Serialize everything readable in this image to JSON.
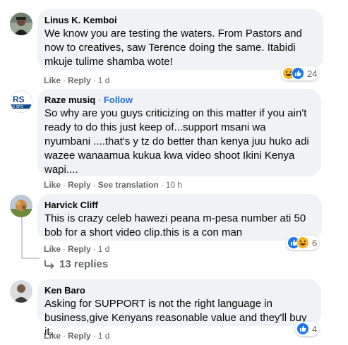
{
  "comments": [
    {
      "author": "Linus K. Kemboi",
      "follow": "",
      "text": "We know you are testing the waters. From Pastors and now to creatives, saw Terence doing the same. Itabidi mkuje tulime shamba wote!",
      "actions": {
        "like": "Like",
        "reply": "Reply",
        "translation": "",
        "time": "1 d"
      },
      "reactions": {
        "icons": [
          "haha-icon",
          "like-icon"
        ],
        "count": "24"
      }
    },
    {
      "author": "Raze musiq",
      "follow": "Follow",
      "text": "So why are you guys criticizing on this matter if you ain't ready to do this just keep of...support msani wa nyumbani ....that's y tz do better than kenya juu huko adi wazee wanaamua kukua kwa video shoot Ikini Kenya wapi....",
      "actions": {
        "like": "Like",
        "reply": "Reply",
        "translation": "See translation",
        "time": "10 h"
      },
      "reactions": {
        "icons": [],
        "count": ""
      }
    },
    {
      "author": "Harvick Cliff",
      "follow": "",
      "text": "This is crazy celeb hawezi peana m-pesa number ati 50 bob for a short video clip.this is a con man",
      "actions": {
        "like": "Like",
        "reply": "Reply",
        "translation": "",
        "time": "1 d"
      },
      "reactions": {
        "icons": [
          "like-icon",
          "haha-icon"
        ],
        "count": "6"
      }
    },
    {
      "author": "Ken Baro",
      "follow": "",
      "text": "Asking for SUPPORT is not the right language in business,give Kenyans reasonable value and they'll buy it.",
      "actions": {
        "like": "Like",
        "reply": "Reply",
        "translation": "",
        "time": "1 d"
      },
      "reactions": {
        "icons": [
          "like-icon"
        ],
        "count": "4"
      }
    }
  ],
  "replies_link": "13 replies",
  "colors": {
    "bubble": "#f0f2f5",
    "secondary_text": "#65676b",
    "follow": "#216fdb",
    "like_blue": "#1877f2",
    "haha_yellow": "#f7b125"
  }
}
